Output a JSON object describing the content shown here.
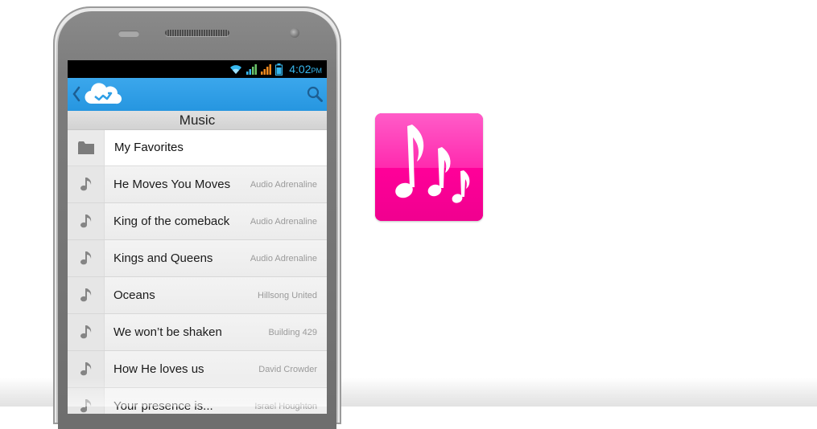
{
  "status_bar": {
    "time": "4:02",
    "ampm": "PM"
  },
  "action_bar": {
    "back_icon": "chevron-left-icon",
    "logo_icon": "cloud-logo-icon",
    "search_icon": "search-icon",
    "accent": "#2f9fe6"
  },
  "section_title": "Music",
  "folder": {
    "label": "My Favorites",
    "icon": "folder-icon"
  },
  "tracks": [
    {
      "title": "He Moves You Moves",
      "artist": "Audio Adrenaline"
    },
    {
      "title": "King of the comeback",
      "artist": "Audio Adrenaline"
    },
    {
      "title": "Kings and Queens",
      "artist": "Audio Adrenaline"
    },
    {
      "title": "Oceans",
      "artist": "Hillsong United"
    },
    {
      "title": "We won’t be shaken",
      "artist": "Building 429"
    },
    {
      "title": "How He loves us",
      "artist": "David Crowder"
    },
    {
      "title": "Your presence is...",
      "artist": "Israel Houghton"
    }
  ],
  "app_icon": {
    "icon": "music-notes-icon",
    "color": "#ff00a0"
  }
}
